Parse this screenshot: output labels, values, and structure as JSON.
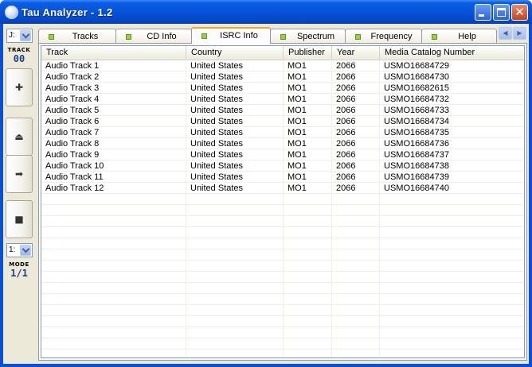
{
  "window": {
    "title": "Tau Analyzer - 1.2",
    "controls": {
      "minimize": "minimize-icon",
      "maximize": "maximize-icon",
      "close": "close-icon"
    }
  },
  "left_panel": {
    "drive_value": "J:",
    "track_label": "TRACK",
    "track_value": "00",
    "buttons": [
      {
        "name": "add-button",
        "icon": "plus-icon",
        "glyph": "✚"
      },
      {
        "name": "eject-button",
        "icon": "eject-icon",
        "glyph": "⏏"
      },
      {
        "name": "next-button",
        "icon": "arrow-right-icon",
        "glyph": "➡"
      },
      {
        "name": "stop-button",
        "icon": "stop-icon",
        "glyph": "■"
      }
    ],
    "mode_select_value": "1:",
    "mode_label": "MODE",
    "mode_value": "1/1"
  },
  "tabs": [
    {
      "label": "Tracks",
      "active": false
    },
    {
      "label": "CD Info",
      "active": false
    },
    {
      "label": "ISRC Info",
      "active": true
    },
    {
      "label": "Spectrum",
      "active": false
    },
    {
      "label": "Frequency",
      "active": false
    },
    {
      "label": "Help",
      "active": false
    }
  ],
  "table": {
    "columns": [
      "Track",
      "Country",
      "Publisher",
      "Year",
      "Media Catalog Number"
    ],
    "rows": [
      [
        "Audio Track 1",
        "United States",
        "MO1",
        "2066",
        "USMO16684729"
      ],
      [
        "Audio Track 2",
        "United States",
        "MO1",
        "2066",
        "USMO16684730"
      ],
      [
        "Audio Track 3",
        "United States",
        "MO1",
        "2066",
        "USMO16682615"
      ],
      [
        "Audio Track 4",
        "United States",
        "MO1",
        "2066",
        "USMO16684732"
      ],
      [
        "Audio Track 5",
        "United States",
        "MO1",
        "2066",
        "USMO16684733"
      ],
      [
        "Audio Track 6",
        "United States",
        "MO1",
        "2066",
        "USMO16684734"
      ],
      [
        "Audio Track 7",
        "United States",
        "MO1",
        "2066",
        "USMO16684735"
      ],
      [
        "Audio Track 8",
        "United States",
        "MO1",
        "2066",
        "USMO16684736"
      ],
      [
        "Audio Track 9",
        "United States",
        "MO1",
        "2066",
        "USMO16684737"
      ],
      [
        "Audio Track 10",
        "United States",
        "MO1",
        "2066",
        "USMO16684738"
      ],
      [
        "Audio Track 11",
        "United States",
        "MO1",
        "2066",
        "USMO16684739"
      ],
      [
        "Audio Track 12",
        "United States",
        "MO1",
        "2066",
        "USMO16684740"
      ]
    ]
  },
  "colors": {
    "titlebar": "#0553d8",
    "tab_active_accent": "#f5a623",
    "tab_led": "#8fd63d",
    "panel_value": "#1c3f8c"
  }
}
